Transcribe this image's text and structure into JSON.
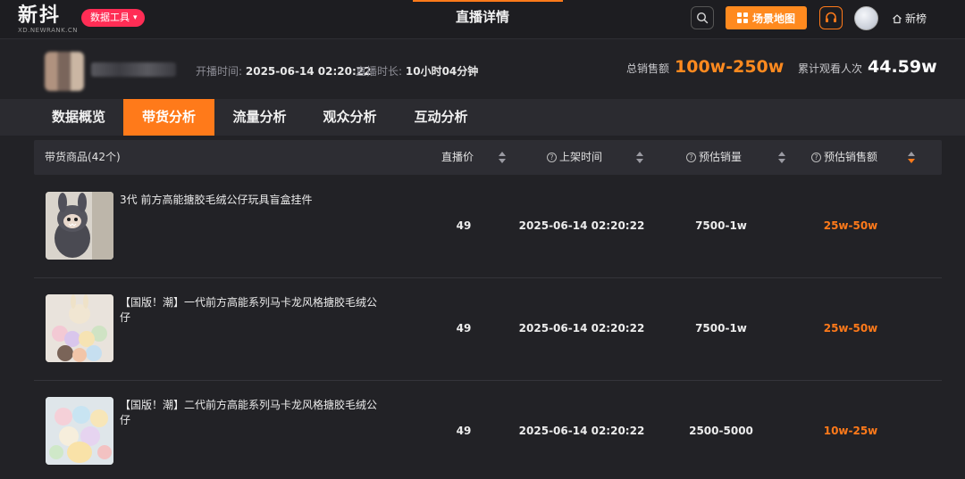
{
  "topbar": {
    "logo": "新抖",
    "logo_sub": "XD.NEWRANK.CN",
    "tool_menu": "数据工具",
    "page_title": "直播详情",
    "scene_map": "场景地图",
    "user_link": "新榜"
  },
  "live": {
    "start_label": "开播时间:",
    "start_value": "2025-06-14 02:20:22",
    "duration_label": "直播时长:",
    "duration_value": "10小时04分钟",
    "sales_label": "总销售额",
    "sales_value": "100w-250w",
    "viewers_label": "累计观看人次",
    "viewers_value": "44.59w"
  },
  "tabs": [
    {
      "label": "数据概览",
      "active": false
    },
    {
      "label": "带货分析",
      "active": true
    },
    {
      "label": "流量分析",
      "active": false
    },
    {
      "label": "观众分析",
      "active": false
    },
    {
      "label": "互动分析",
      "active": false
    }
  ],
  "table": {
    "columns": {
      "product": "带货商品(42个)",
      "price": "直播价",
      "listed": "上架时间",
      "volume": "预估销量",
      "revenue": "预估销售额"
    },
    "rows": [
      {
        "name": "3代 前方高能搪胶毛绒公仔玩具盲盒挂件",
        "price": "49",
        "listed": "2025-06-14 02:20:22",
        "volume": "7500-1w",
        "revenue": "25w-50w"
      },
      {
        "name": "【国版！潮】一代前方高能系列马卡龙风格搪胶毛绒公仔",
        "price": "49",
        "listed": "2025-06-14 02:20:22",
        "volume": "7500-1w",
        "revenue": "25w-50w"
      },
      {
        "name": "【国版！潮】二代前方高能系列马卡龙风格搪胶毛绒公仔",
        "price": "49",
        "listed": "2025-06-14 02:20:22",
        "volume": "2500-5000",
        "revenue": "10w-25w"
      }
    ]
  },
  "colors": {
    "accent": "#ff7a1a",
    "brand_pink": "#ff2d55",
    "background": "#222226"
  }
}
